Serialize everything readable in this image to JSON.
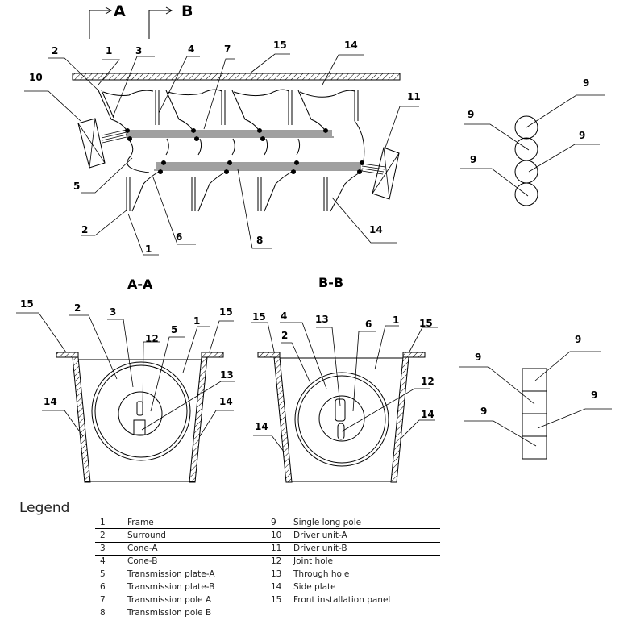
{
  "section_markers": [
    {
      "label": "A"
    },
    {
      "label": "B"
    }
  ],
  "main_view": {
    "callouts": [
      "2",
      "1",
      "3",
      "4",
      "7",
      "15",
      "14",
      "10",
      "11",
      "5",
      "2",
      "1",
      "6",
      "8",
      "14"
    ]
  },
  "pole_views": {
    "round_callouts": [
      "9",
      "9",
      "9",
      "9"
    ],
    "square_callouts": [
      "9",
      "9",
      "9",
      "9"
    ]
  },
  "section_aa": {
    "title": "A-A",
    "callouts": [
      "15",
      "2",
      "3",
      "12",
      "5",
      "1",
      "15",
      "13",
      "14",
      "14"
    ]
  },
  "section_bb": {
    "title": "B-B",
    "callouts": [
      "15",
      "4",
      "13",
      "6",
      "1",
      "15",
      "2",
      "12",
      "14",
      "14"
    ]
  },
  "legend": {
    "title": "Legend",
    "left": [
      {
        "num": "1",
        "text": "Frame"
      },
      {
        "num": "2",
        "text": "Surround"
      },
      {
        "num": "3",
        "text": "Cone-A"
      },
      {
        "num": "4",
        "text": "Cone-B"
      },
      {
        "num": "5",
        "text": "Transmission plate-A"
      },
      {
        "num": "6",
        "text": "Transmission plate-B"
      },
      {
        "num": "7",
        "text": "Transmission pole A"
      },
      {
        "num": "8",
        "text": "Transmission pole B"
      }
    ],
    "right": [
      {
        "num": "9",
        "text": "Single long pole"
      },
      {
        "num": "10",
        "text": "Driver unit-A"
      },
      {
        "num": "11",
        "text": "Driver unit-B"
      },
      {
        "num": "12",
        "text": "Joint hole"
      },
      {
        "num": "13",
        "text": "Through hole"
      },
      {
        "num": "14",
        "text": "Side plate"
      },
      {
        "num": "15",
        "text": "Front installation panel"
      }
    ]
  }
}
